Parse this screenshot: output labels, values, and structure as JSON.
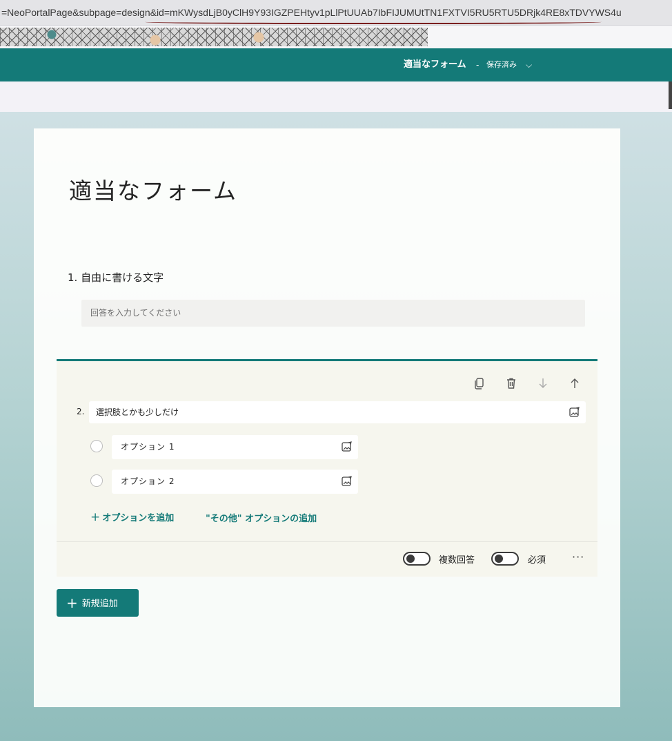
{
  "browser": {
    "url": "=NeoPortalPage&subpage=design&id=mKWysdLjB0yClH9Y93IGZPEHtyv1pLlPtUUAb7IbFIJUMUtTN1FXTVI5RU5RTU5DRjk4RE8xTDVYWS4u"
  },
  "header": {
    "form_name": "適当なフォーム",
    "separator": "-",
    "save_status": "保存済み",
    "chevron": "⌵",
    "brand_color": "#147a78"
  },
  "form": {
    "title": "適当なフォーム",
    "questions": [
      {
        "number": "1.",
        "title": "自由に書ける文字",
        "placeholder": "回答を入力してください"
      },
      {
        "number": "2.",
        "title": "選択肢とかも少しだけ",
        "options": [
          "オプション 1",
          "オプション 2"
        ],
        "add_option_label": "オプションを追加",
        "add_other_label": "\"その他\" オプションの追加",
        "multiple_answers_label": "複数回答",
        "required_label": "必須",
        "more_label": "···"
      }
    ]
  },
  "toolbar": {
    "icons": [
      "copy-icon",
      "delete-icon",
      "move-down-icon",
      "move-up-icon"
    ]
  },
  "add_new_button": {
    "label": "新規追加"
  }
}
